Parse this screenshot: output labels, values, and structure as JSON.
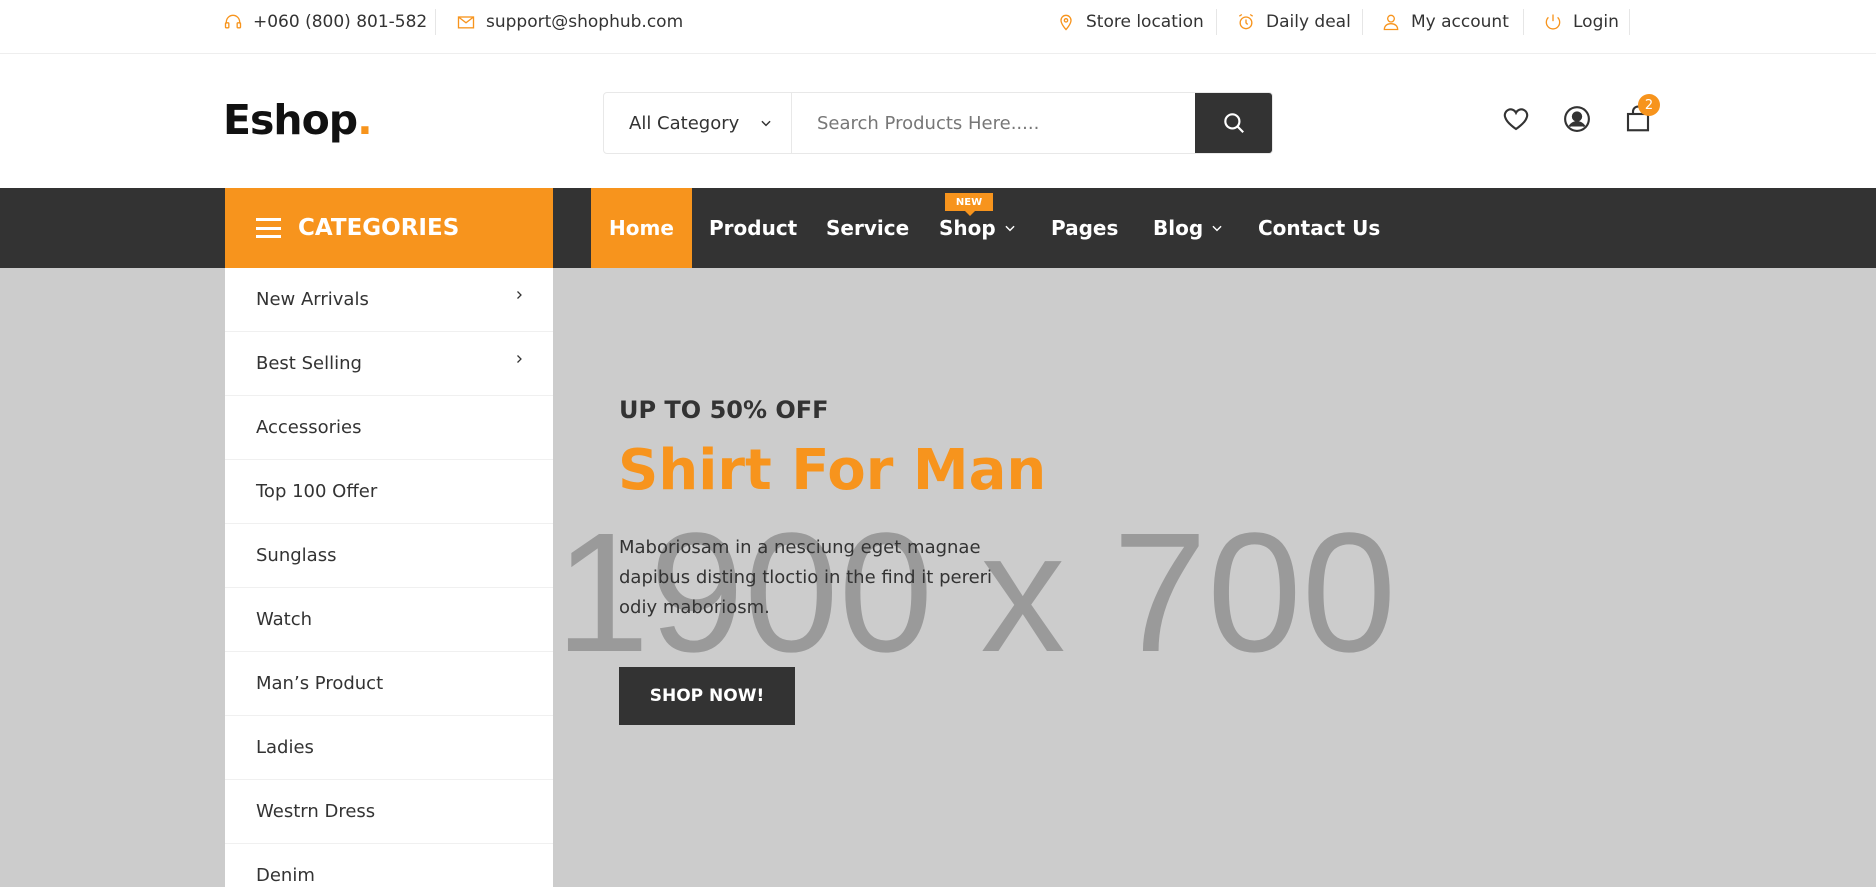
{
  "topbar": {
    "phone": "+060 (800) 801-582",
    "email": "support@shophub.com",
    "store_location": "Store location",
    "daily_deal": "Daily deal",
    "my_account": "My account",
    "login": "Login"
  },
  "header": {
    "logo_text": "Eshop",
    "logo_dot": ".",
    "category_select": "All Category",
    "search_placeholder": "Search Products Here.....",
    "cart_count": "2"
  },
  "nav": {
    "categories_label": "CATEGORIES",
    "items": [
      "Home",
      "Product",
      "Service",
      "Shop",
      "Pages",
      "Blog",
      "Contact Us"
    ],
    "new_badge": "NEW"
  },
  "categories": [
    "New Arrivals",
    "Best Selling",
    "Accessories",
    "Top 100 Offer",
    "Sunglass",
    "Watch",
    "Man’s Product",
    "Ladies",
    "Westrn Dress",
    "Denim"
  ],
  "hero": {
    "placeholder_text": "1900 x 700",
    "kicker": "UP TO 50% OFF",
    "title": "Shirt For Man",
    "description": "Maboriosam in a nesciung eget magnae dapibus disting tloctio in the find it pereri odiy maboriosm.",
    "button": "SHOP NOW!"
  },
  "colors": {
    "accent": "#f7941d",
    "dark": "#333333",
    "hero_bg": "#cccccc"
  }
}
